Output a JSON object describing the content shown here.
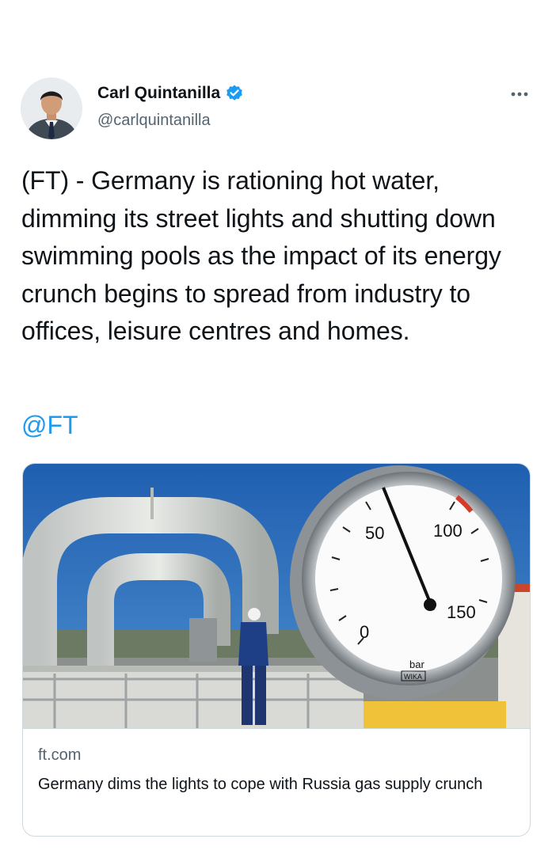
{
  "author": {
    "display_name": "Carl Quintanilla",
    "handle": "@carlquintanilla",
    "verified": true,
    "verified_icon": "verified-badge-icon"
  },
  "tweet": {
    "text": "(FT) - Germany is rationing hot water, dimming its street lights and shutting down swimming pools as the impact of its energy crunch begins to spread from industry to offices, leisure centres and homes.",
    "mention": "@FT"
  },
  "card": {
    "domain": "ft.com",
    "title": "Germany dims the lights to cope with Russia gas supply crunch",
    "image_gauge_labels": [
      "50",
      "100",
      "150",
      "0",
      "bar",
      "WIKA"
    ]
  },
  "colors": {
    "link": "#1d9bf0",
    "text": "#0f1419",
    "secondary": "#536471",
    "border": "#cfd9de"
  }
}
